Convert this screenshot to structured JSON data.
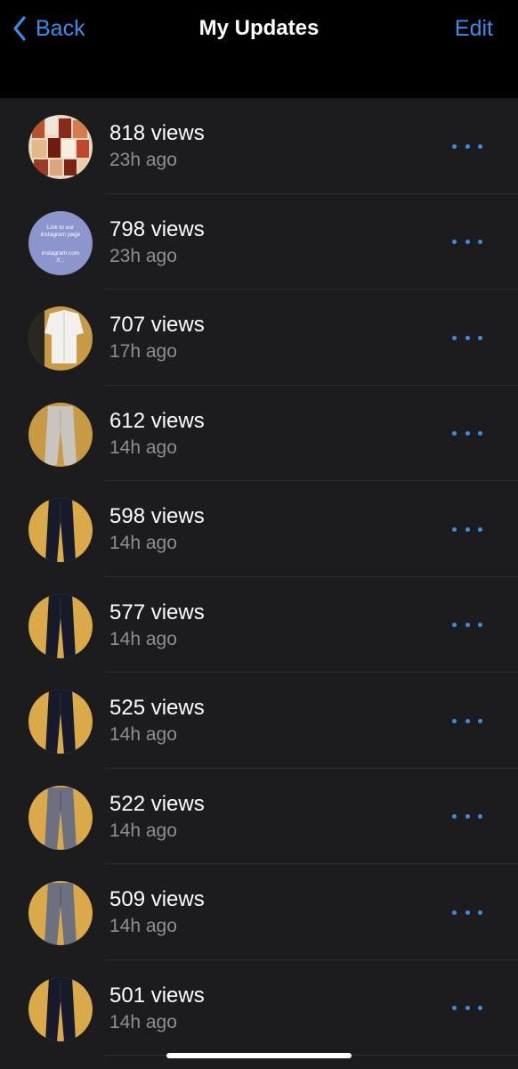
{
  "nav": {
    "back_label": "Back",
    "title": "My Updates",
    "edit_label": "Edit"
  },
  "updates": [
    {
      "views": "818 views",
      "time": "23h ago",
      "thumb": "collage"
    },
    {
      "views": "798 views",
      "time": "23h ago",
      "thumb": "link",
      "thumb_text": [
        "Link to our",
        "instagram page",
        "instagram.com",
        "/f..."
      ]
    },
    {
      "views": "707 views",
      "time": "17h ago",
      "thumb": "shirt"
    },
    {
      "views": "612 views",
      "time": "14h ago",
      "thumb": "light-pants"
    },
    {
      "views": "598 views",
      "time": "14h ago",
      "thumb": "dark-pants"
    },
    {
      "views": "577 views",
      "time": "14h ago",
      "thumb": "dark-pants"
    },
    {
      "views": "525 views",
      "time": "14h ago",
      "thumb": "dark-pants"
    },
    {
      "views": "522 views",
      "time": "14h ago",
      "thumb": "grey-pants"
    },
    {
      "views": "509 views",
      "time": "14h ago",
      "thumb": "grey-pants"
    },
    {
      "views": "501 views",
      "time": "14h ago",
      "thumb": "dark-pants"
    }
  ],
  "colors": {
    "accent": "#3a8ee6",
    "background": "#1c1c1e",
    "navbar": "#000000",
    "secondary_text": "#8e8e93"
  },
  "icons": {
    "back": "chevron-left-icon",
    "more": "ellipsis-icon"
  }
}
